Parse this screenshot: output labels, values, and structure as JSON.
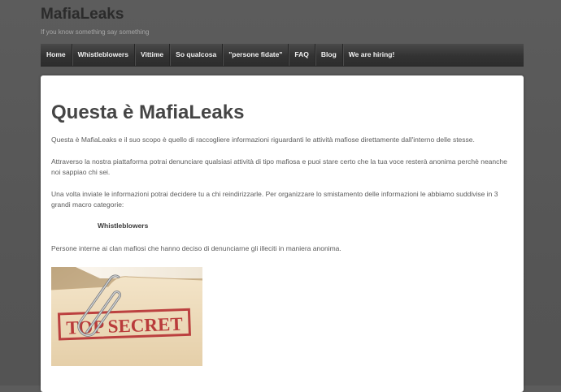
{
  "site": {
    "title": "MafiaLeaks",
    "tagline": "If you know something say something"
  },
  "nav": {
    "items": [
      {
        "label": "Home"
      },
      {
        "label": "Whistleblowers"
      },
      {
        "label": "Vittime"
      },
      {
        "label": "So qualcosa"
      },
      {
        "label": "\"persone fidate\""
      },
      {
        "label": "FAQ"
      },
      {
        "label": "Blog"
      },
      {
        "label": "We are hiring!"
      }
    ]
  },
  "page": {
    "title": "Questa è MafiaLeaks",
    "paragraphs": [
      "Questa è MafiaLeaks e il suo scopo è quello di raccogliere informazioni riguardanti le attività mafiose direttamente dall'interno delle stesse.",
      "Attraverso la nostra piattaforma potrai denunciare qualsiasi attività di tipo mafiosa e puoi stare certo che la tua voce resterà anonima perchè neanche noi sappiao chi sei.",
      "Una volta inviate le informazioni potrai decidere tu a chi reindirizzarle. Per organizzare lo smistamento delle informazioni le abbiamo suddivise in 3 grandi macro categorie:"
    ],
    "category": "Whistleblowers",
    "category_text": "Persone interne ai clan mafiosi che hanno deciso di denunciarne gli illeciti in maniera anonima.",
    "image": {
      "stamp_text": "TOP SECRET",
      "stamp_color": "#b3262a"
    }
  }
}
